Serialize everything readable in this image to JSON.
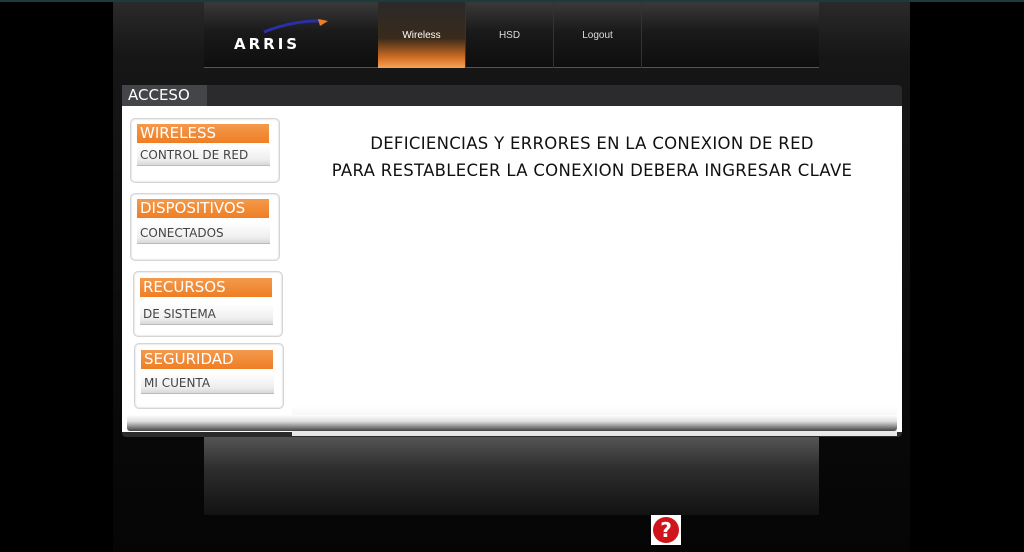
{
  "header": {
    "logo_text": "ARRIS",
    "nav": [
      "Wireless",
      "HSD",
      "Logout"
    ],
    "active_nav": "Wireless"
  },
  "panel": {
    "tab_label": "ACCESO",
    "message_line1": "DEFICIENCIAS Y ERRORES EN LA CONEXION DE RED",
    "message_line2": "PARA RESTABLECER LA CONEXION DEBERA INGRESAR CLAVE"
  },
  "sidebar": {
    "sections": [
      {
        "title": "WIRELESS",
        "item": "CONTROL DE RED"
      },
      {
        "title": "DISPOSITIVOS",
        "item": "CONECTADOS"
      },
      {
        "title": "RECURSOS",
        "item": "DE SISTEMA"
      },
      {
        "title": "SEGURIDAD",
        "item": "MI CUENTA"
      }
    ]
  },
  "help": {
    "glyph": "?"
  },
  "colors": {
    "accent": "#ef7e25",
    "help_red": "#d0141b",
    "brand_blue": "#2a2fa8"
  }
}
